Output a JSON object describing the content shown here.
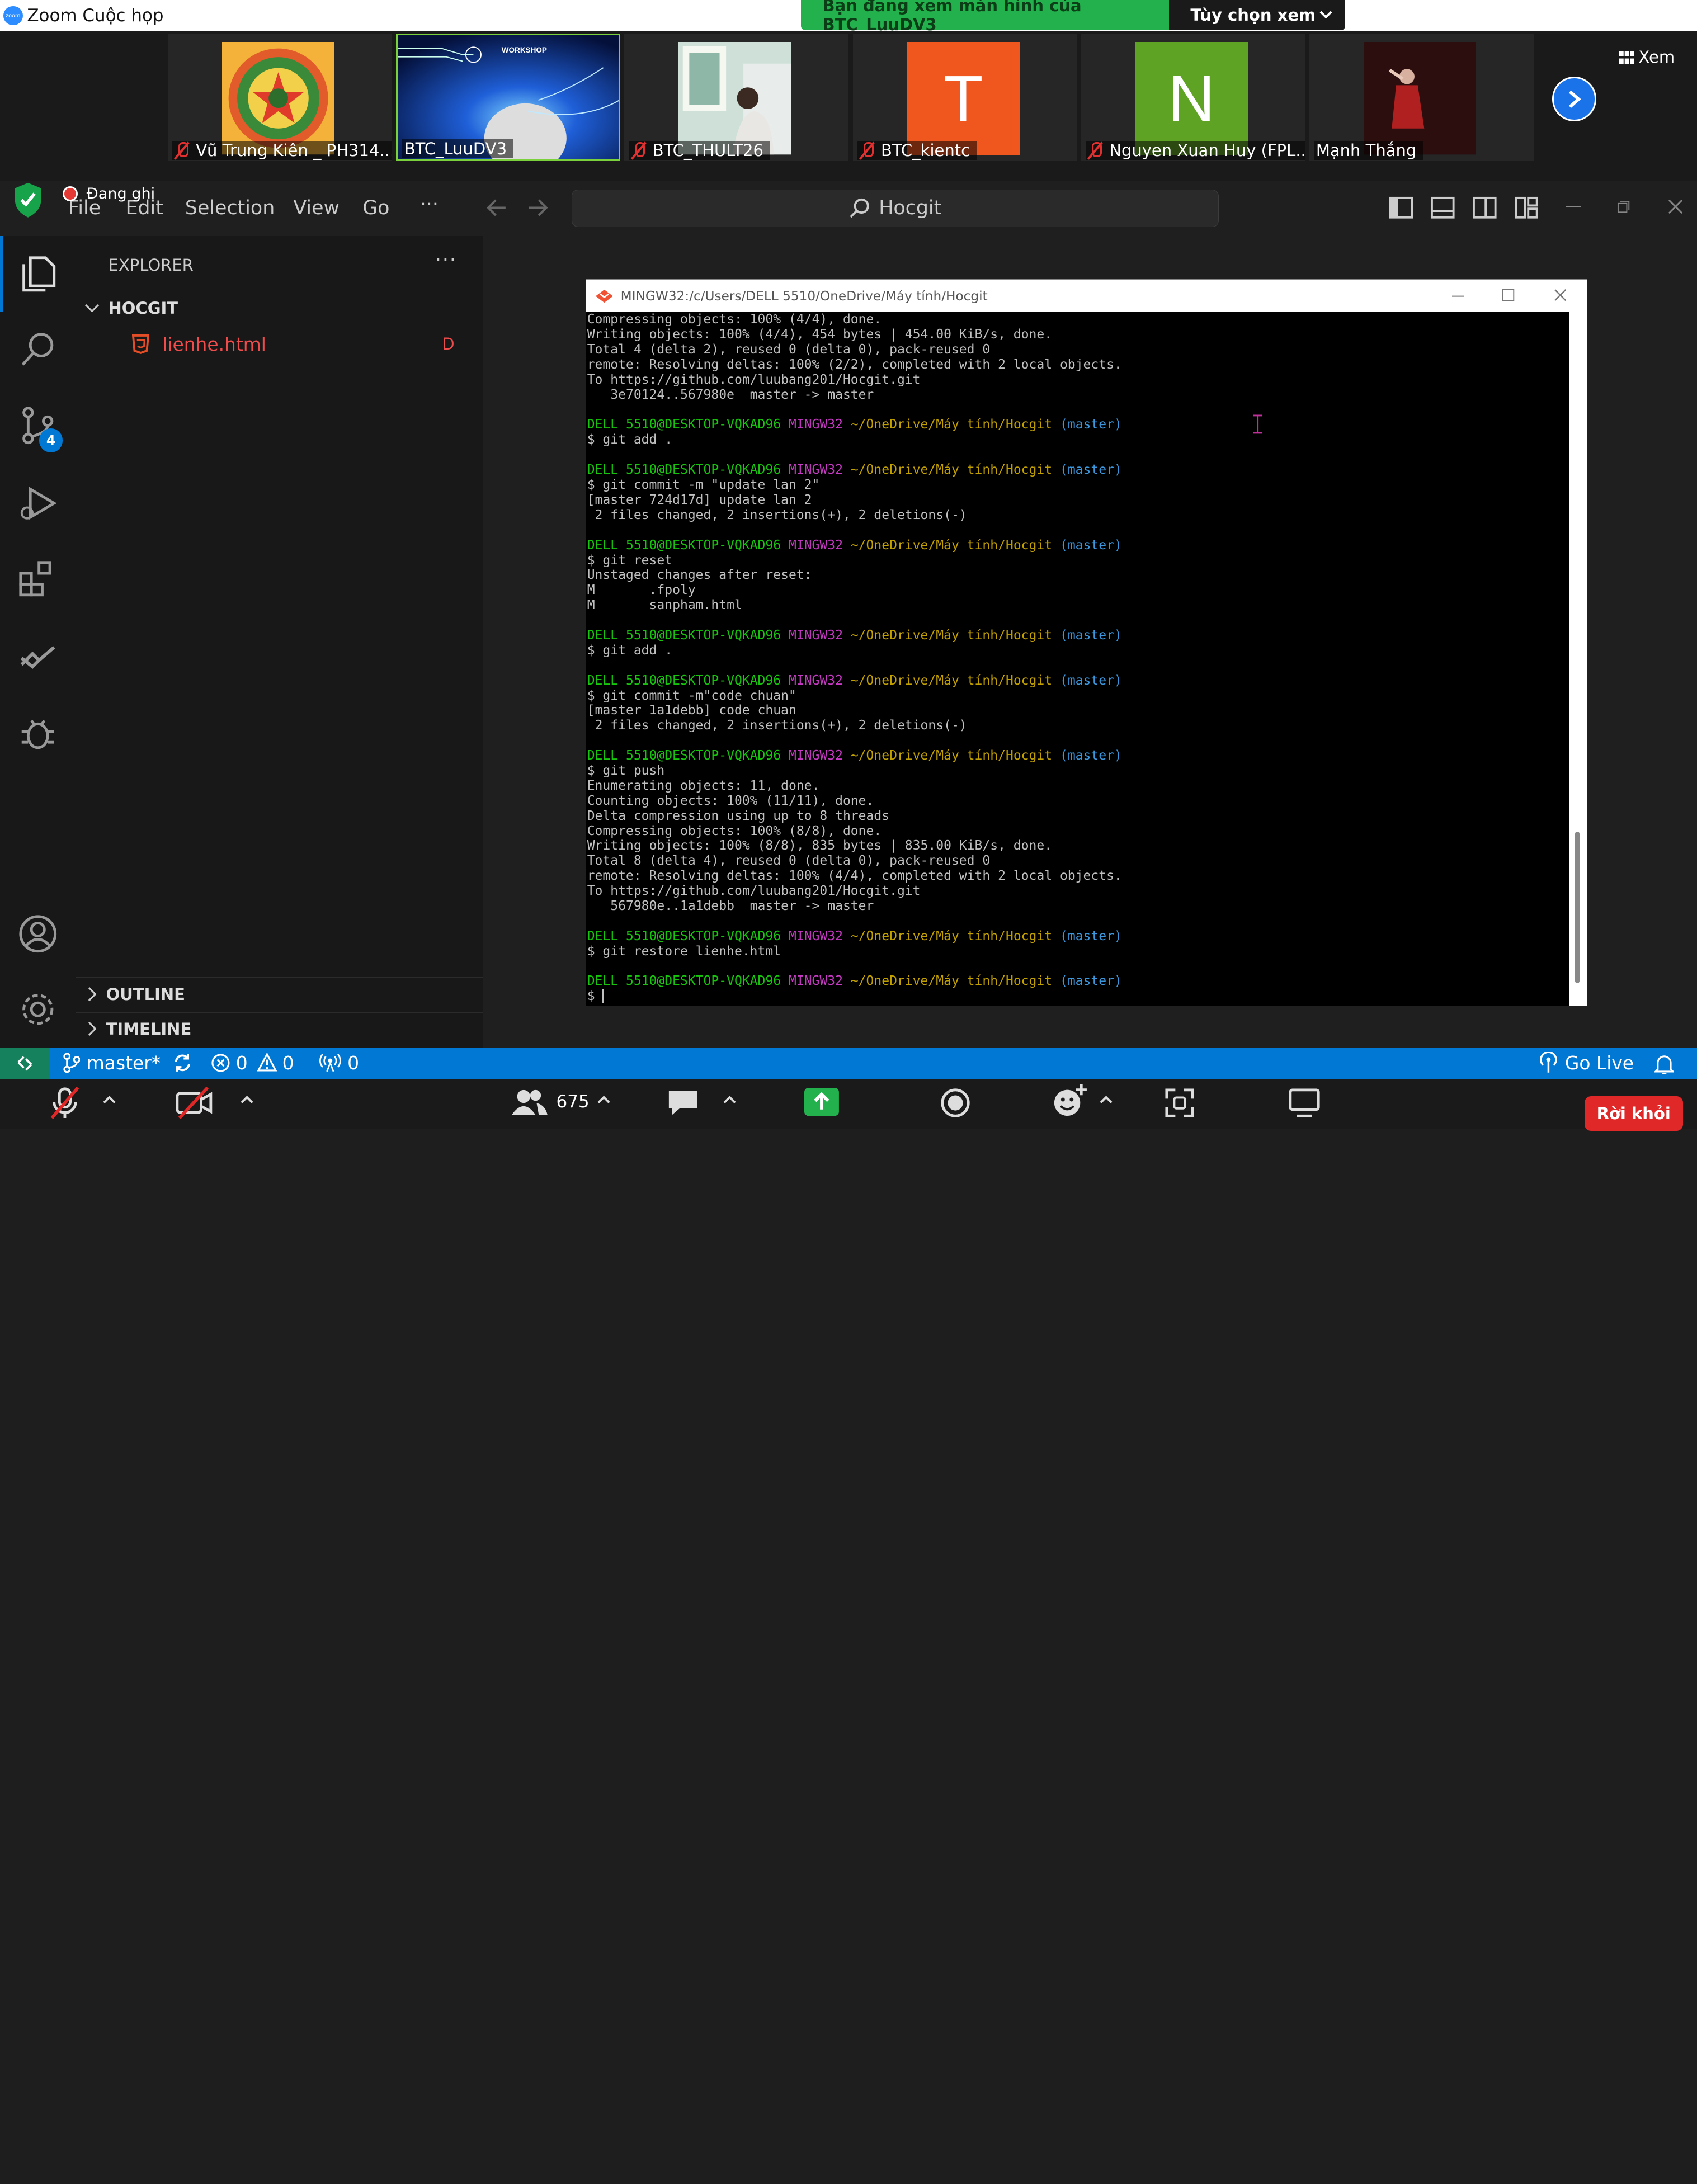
{
  "zoom": {
    "window_title": "Zoom Cuộc họp",
    "logo_text": "zoom",
    "viewing_banner": "Bạn đang xem màn hình của BTC_LuuDV3",
    "view_options_label": "Tùy chọn xem",
    "view_button_label": "Xem",
    "participants": [
      {
        "name": "Vũ Trung Kiên _ PH314...",
        "muted": true,
        "avatar": "emblem"
      },
      {
        "name": "BTC_LuuDV3",
        "muted": false,
        "avatar": "workshop",
        "active_speaker": true,
        "overlay_text": "WORKSHOP"
      },
      {
        "name": "BTC_THULT26",
        "muted": true,
        "avatar": "photo"
      },
      {
        "name": "BTC_kientc",
        "muted": true,
        "avatar_letter": "T",
        "avatar_color": "#f0571f"
      },
      {
        "name": "Nguyen Xuan Huy (FPL...",
        "muted": true,
        "avatar_letter": "N",
        "avatar_color": "#5fa324"
      },
      {
        "name": "Mạnh Thắng",
        "muted": false,
        "avatar": "photo-dark"
      }
    ],
    "recording_label": "Đang ghi",
    "participant_count": "675",
    "leave_label": "Rời khỏi"
  },
  "vscode": {
    "menu": [
      "File",
      "Edit",
      "Selection",
      "View",
      "Go",
      "···"
    ],
    "search_placeholder": "Hocgit",
    "source_control_badge": "4",
    "explorer_title": "EXPLORER",
    "explorer_more": "···",
    "folder_name": "HOCGIT",
    "files": [
      {
        "name": "lienhe.html",
        "status": "D"
      }
    ],
    "outline_label": "OUTLINE",
    "timeline_label": "TIMELINE",
    "status": {
      "branch": "master*",
      "errors": "0",
      "warnings": "0",
      "ports": "0",
      "go_live": "Go Live"
    }
  },
  "terminal": {
    "title": "MINGW32:/c/Users/DELL 5510/OneDrive/Máy tính/Hocgit",
    "prompt": {
      "user": "DELL 5510@DESKTOP-VQKAD96",
      "env": "MINGW32",
      "path": "~/OneDrive/Máy tính/Hocgit",
      "branch": "(master)"
    },
    "lines": [
      {
        "t": "Compressing objects: 100% (4/4), done."
      },
      {
        "t": "Writing objects: 100% (4/4), 454 bytes | 454.00 KiB/s, done."
      },
      {
        "t": "Total 4 (delta 2), reused 0 (delta 0), pack-reused 0"
      },
      {
        "t": "remote: Resolving deltas: 100% (2/2), completed with 2 local objects."
      },
      {
        "t": "To https://github.com/luubang201/Hocgit.git"
      },
      {
        "t": "   3e70124..567980e  master -> master"
      },
      {
        "t": ""
      },
      {
        "p": true
      },
      {
        "t": "$ git add ."
      },
      {
        "t": ""
      },
      {
        "p": true
      },
      {
        "t": "$ git commit -m \"update lan 2\""
      },
      {
        "t": "[master 724d17d] update lan 2"
      },
      {
        "t": " 2 files changed, 2 insertions(+), 2 deletions(-)"
      },
      {
        "t": ""
      },
      {
        "p": true
      },
      {
        "t": "$ git reset"
      },
      {
        "t": "Unstaged changes after reset:"
      },
      {
        "t": "M       .fpoly"
      },
      {
        "t": "M       sanpham.html"
      },
      {
        "t": ""
      },
      {
        "p": true
      },
      {
        "t": "$ git add ."
      },
      {
        "t": ""
      },
      {
        "p": true
      },
      {
        "t": "$ git commit -m\"code chuan\""
      },
      {
        "t": "[master 1a1debb] code chuan"
      },
      {
        "t": " 2 files changed, 2 insertions(+), 2 deletions(-)"
      },
      {
        "t": ""
      },
      {
        "p": true
      },
      {
        "t": "$ git push"
      },
      {
        "t": "Enumerating objects: 11, done."
      },
      {
        "t": "Counting objects: 100% (11/11), done."
      },
      {
        "t": "Delta compression using up to 8 threads"
      },
      {
        "t": "Compressing objects: 100% (8/8), done."
      },
      {
        "t": "Writing objects: 100% (8/8), 835 bytes | 835.00 KiB/s, done."
      },
      {
        "t": "Total 8 (delta 4), reused 0 (delta 0), pack-reused 0"
      },
      {
        "t": "remote: Resolving deltas: 100% (4/4), completed with 2 local objects."
      },
      {
        "t": "To https://github.com/luubang201/Hocgit.git"
      },
      {
        "t": "   567980e..1a1debb  master -> master"
      },
      {
        "t": ""
      },
      {
        "p": true
      },
      {
        "t": "$ git restore lienhe.html"
      },
      {
        "t": ""
      },
      {
        "p": true
      },
      {
        "t": "$ "
      }
    ]
  },
  "colors": {
    "vscode_status": "#0078d4",
    "remote_indicator": "#16825d",
    "deleted_file": "#f14c4c",
    "term_green": "#16c60c",
    "term_magenta": "#c839c5",
    "term_yellow": "#c1a000",
    "term_cyan": "#3a96dd",
    "zoom_banner": "#22b14c",
    "leave": "#e02828"
  }
}
